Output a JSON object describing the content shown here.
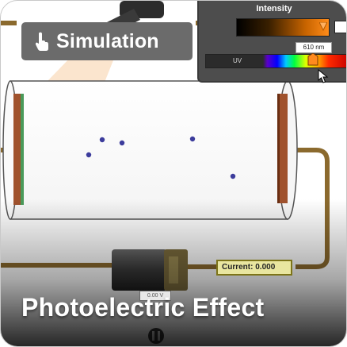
{
  "badge": {
    "icon": "pointer-hand-icon",
    "label": "Simulation"
  },
  "intensity_panel": {
    "title": "Intensity",
    "wavelength_value": "610 nm",
    "uv_label": "UV"
  },
  "current_readout": {
    "label": "Current:",
    "value": "0.000"
  },
  "voltage_readout": "0.00 V",
  "banner_title": "Photoelectric Effect",
  "colors": {
    "chip_bg": "#6b6b6b",
    "panel_bg": "#4d4d4d",
    "wire": "#8b6a2e",
    "plate": "#a0522d",
    "electron": "#3c3c9c"
  }
}
